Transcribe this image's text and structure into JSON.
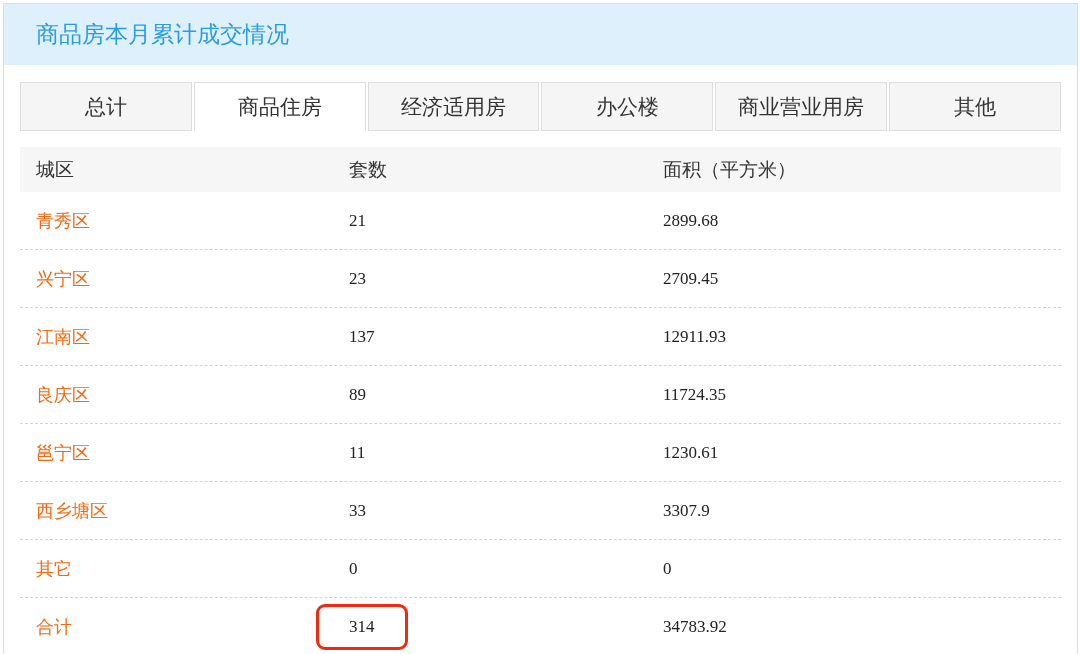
{
  "panel": {
    "title": "商品房本月累计成交情况"
  },
  "tabs": [
    {
      "label": "总计",
      "selected": false
    },
    {
      "label": "商品住房",
      "selected": true
    },
    {
      "label": "经济适用房",
      "selected": false
    },
    {
      "label": "办公楼",
      "selected": false
    },
    {
      "label": "商业营业用房",
      "selected": false
    },
    {
      "label": "其他",
      "selected": false
    }
  ],
  "table": {
    "columns": [
      "城区",
      "套数",
      "面积（平方米）"
    ],
    "rows": [
      {
        "district": "青秀区",
        "units": "21",
        "area": "2899.68",
        "highlighted": false
      },
      {
        "district": "兴宁区",
        "units": "23",
        "area": "2709.45",
        "highlighted": false
      },
      {
        "district": "江南区",
        "units": "137",
        "area": "12911.93",
        "highlighted": false
      },
      {
        "district": "良庆区",
        "units": "89",
        "area": "11724.35",
        "highlighted": false
      },
      {
        "district": "邕宁区",
        "units": "11",
        "area": "1230.61",
        "highlighted": false
      },
      {
        "district": "西乡塘区",
        "units": "33",
        "area": "3307.9",
        "highlighted": false
      },
      {
        "district": "其它",
        "units": "0",
        "area": "0",
        "highlighted": false
      },
      {
        "district": "合计",
        "units": "314",
        "area": "34783.92",
        "highlighted": true
      }
    ]
  }
}
